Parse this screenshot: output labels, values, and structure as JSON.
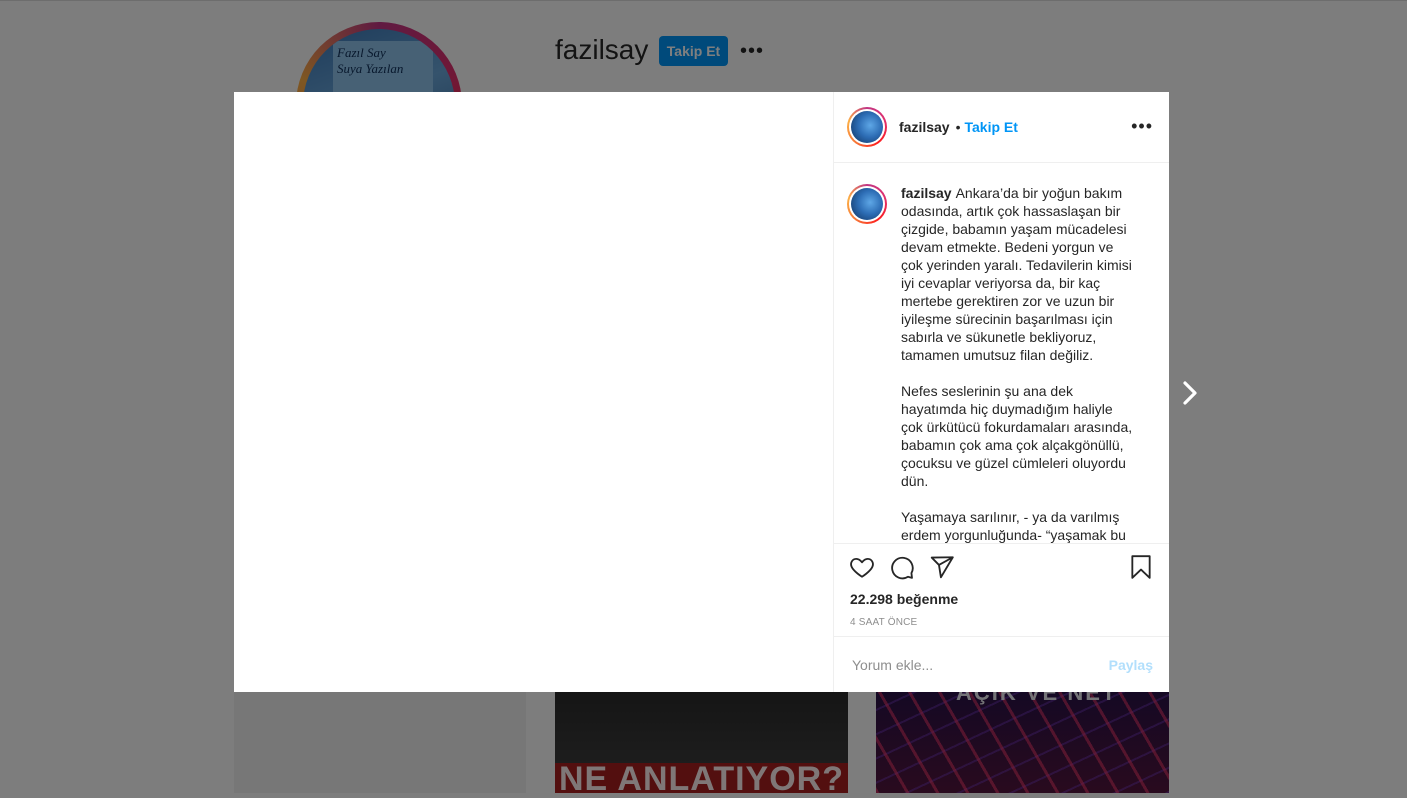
{
  "profile": {
    "username": "fazilsay",
    "follow_label": "Takip Et",
    "more_label": "•••",
    "avatar_book_text": "Fazıl Say\nSuya Yazılan"
  },
  "grid": {
    "tile2_text": "NE ANLATIYOR?",
    "tile3_text": "AÇIK VE NET"
  },
  "post": {
    "header": {
      "username": "fazilsay",
      "separator": "•",
      "follow_label": "Takip Et",
      "more_label": "•••"
    },
    "caption": {
      "username": "fazilsay",
      "paragraphs": [
        "Ankara’da bir yoğun bakım odasında, artık çok hassaslaşan bir çizgide, babamın yaşam mücadelesi devam etmekte. Bedeni yorgun ve çok yerinden yaralı. Tedavilerin kimisi iyi cevaplar veriyorsa da, bir kaç mertebe gerektiren zor ve uzun bir iyileşme sürecinin başarılması için sabırla ve sükunetle bekliyoruz, tamamen umutsuz filan değiliz.",
        "Nefes seslerinin şu ana dek hayatımda hiç duymadığım haliyle çok ürkütücü fokurdamaları arasında, babamın çok ama çok alçakgönüllü, çocuksu ve güzel cümleleri oluyordu dün.",
        "Yaşamaya sarılınır, - ya da varılmış erdem yorgunluğunda- “yaşamak bu bedene sarılsın ya da yeni doğru"
      ]
    },
    "actions": {
      "like_icon": "heart-icon",
      "comment_icon": "comment-icon",
      "share_icon": "paper-plane-icon",
      "save_icon": "bookmark-icon"
    },
    "likes": "22.298 beğenme",
    "time": "4 SAAT ÖNCE",
    "comment": {
      "placeholder": "Yorum ekle...",
      "post_label": "Paylaş"
    }
  },
  "navigation": {
    "next_icon": "chevron-right-icon"
  },
  "colors": {
    "accent": "#0095f6",
    "disabled_accent": "#b2dffc",
    "overlay": "rgba(0,0,0,0.5)"
  }
}
